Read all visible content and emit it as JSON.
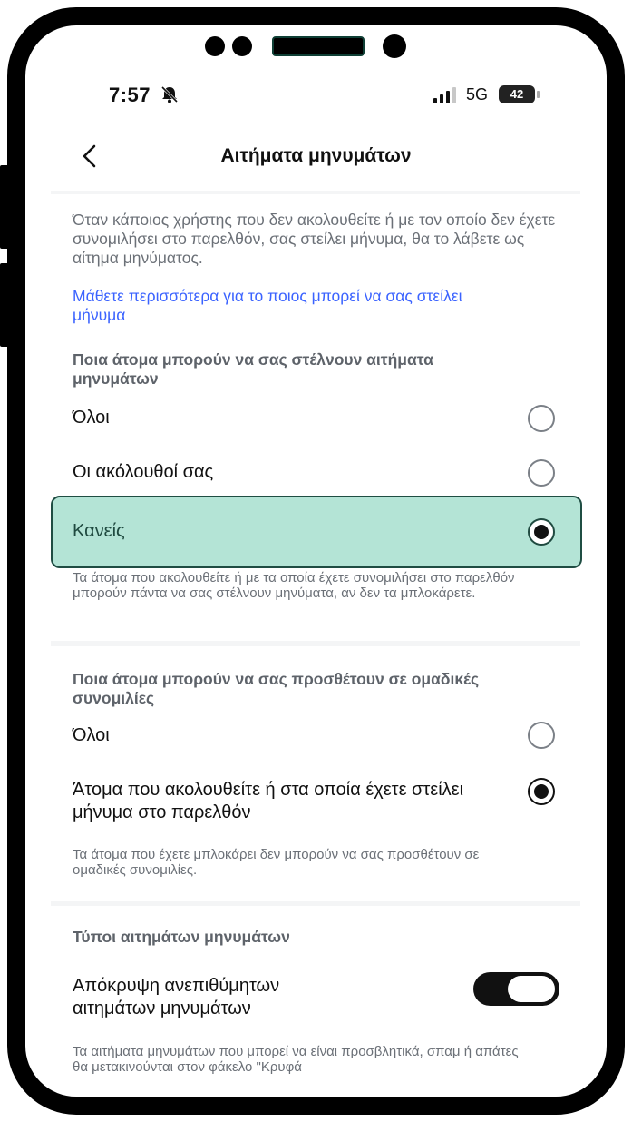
{
  "status_bar": {
    "time": "7:57",
    "network": "5G",
    "battery": "42",
    "icons": [
      "bell-muted-icon",
      "signal-bars-icon",
      "battery-icon"
    ]
  },
  "header": {
    "title": "Αιτήματα μηνυμάτων",
    "back_icon": "chevron-left-icon"
  },
  "intro": {
    "description": "Όταν κάποιος χρήστης που δεν ακολουθείτε ή με τον οποίο δεν έχετε συνομιλήσει στο παρελθόν, σας στείλει μήνυμα, θα το λάβετε ως αίτημα μηνύματος.",
    "link": "Μάθετε περισσότερα για το ποιος μπορεί να σας στείλει μήνυμα"
  },
  "who_can_request": {
    "heading": "Ποια άτομα μπορούν να σας στέλνουν αιτήματα μηνυμάτων",
    "options": [
      {
        "label": "Όλοι",
        "selected": false
      },
      {
        "label": "Οι ακόλουθοί σας",
        "selected": false
      },
      {
        "label": "Κανείς",
        "selected": true
      }
    ],
    "note": "Τα άτομα που ακολουθείτε ή με τα οποία έχετε συνομιλήσει στο παρελθόν μπορούν πάντα να σας στέλνουν μηνύματα, αν δεν τα μπλοκάρετε."
  },
  "group_chats": {
    "heading": "Ποια άτομα μπορούν να σας προσθέτουν σε ομαδικές συνομιλίες",
    "options": [
      {
        "label": "Όλοι",
        "selected": false
      },
      {
        "label": "Άτομα που ακολουθείτε ή στα οποία έχετε στείλει μήνυμα στο παρελθόν",
        "selected": true
      }
    ],
    "note": "Τα άτομα που έχετε μπλοκάρει δεν μπορούν να σας προσθέτουν σε ομαδικές συνομιλίες."
  },
  "request_types": {
    "heading": "Τύποι αιτημάτων μηνυμάτων",
    "toggle_label": "Απόκρυψη ανεπιθύμητων αιτημάτων μηνυμάτων",
    "toggle_on": true,
    "note": "Τα αιτήματα μηνυμάτων που μπορεί να είναι προσβλητικά, σπαμ ή απάτες θα μετακινούνται στον φάκελο \"Κρυφά"
  },
  "colors": {
    "highlight_fill": "#b4e4d6",
    "highlight_border": "#1f4d43",
    "link": "#3b63ff",
    "secondary_text": "#6b7077"
  }
}
